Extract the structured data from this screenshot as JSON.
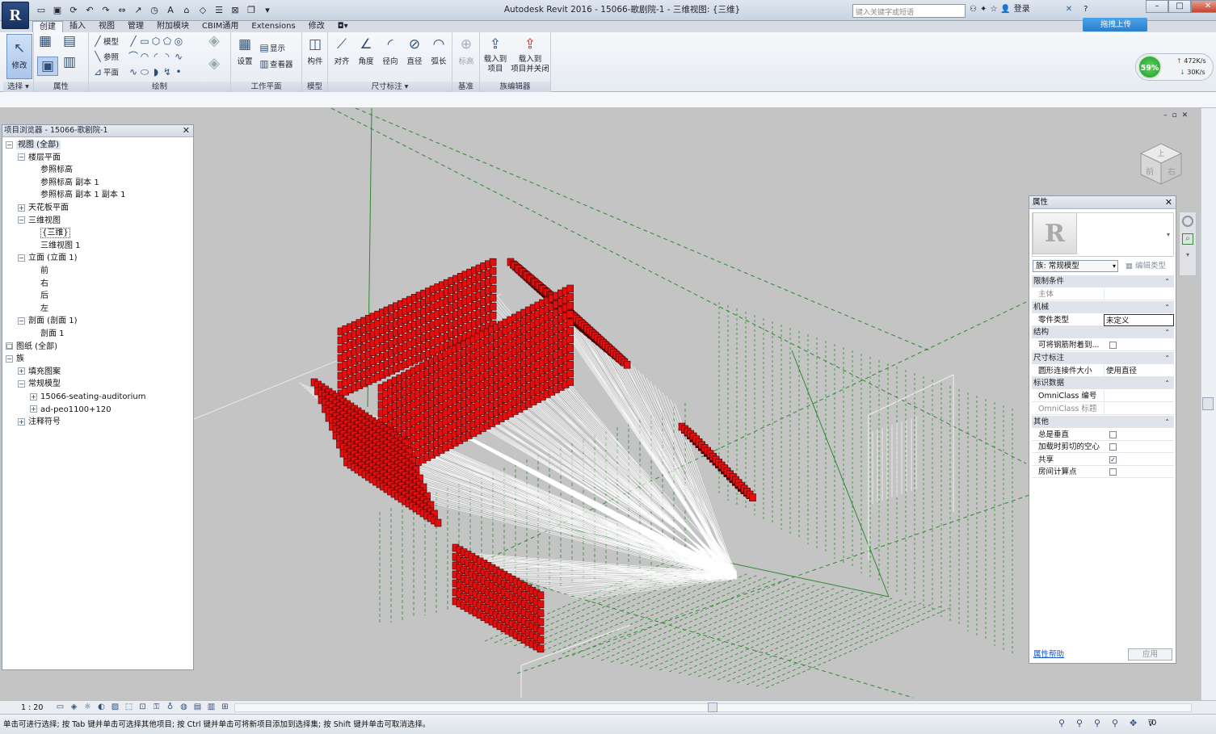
{
  "app": {
    "logo": "R",
    "window_title": "Autodesk Revit 2016 -      15066-歌剧院-1 - 三维视图: {三维}",
    "search_placeholder": "键入关键字或短语",
    "login_label": "登录",
    "upload_label": "拖拽上传",
    "network": {
      "percent": "59%",
      "up": "472K/s",
      "down": "30K/s"
    }
  },
  "quick_access": [
    "open-icon",
    "save-icon",
    "sync-icon",
    "undo-icon",
    "redo-icon",
    "measure-icon",
    "dimension-icon",
    "tag-icon",
    "text-icon",
    "3d-icon",
    "section-icon",
    "thin-lines-icon",
    "close-windows-icon",
    "switch-windows-icon",
    "customize-icon"
  ],
  "tabs": [
    {
      "label": "创建",
      "active": true
    },
    {
      "label": "插入"
    },
    {
      "label": "视图"
    },
    {
      "label": "管理"
    },
    {
      "label": "附加模块"
    },
    {
      "label": "CBIM通用"
    },
    {
      "label": "Extensions"
    },
    {
      "label": "修改"
    }
  ],
  "ribbon": {
    "modify_label": "修改",
    "select_panel": "选择 ▾",
    "properties_panel": "属性",
    "draw_panel": "绘制",
    "draw_items": [
      "模型",
      "参照",
      "平面"
    ],
    "workplane_panel": "工作平面",
    "workplane_items": [
      "设置",
      "显示",
      "查看器"
    ],
    "model_panel": "模型",
    "component_label": "构件",
    "dimension_panel": "尺寸标注 ▾",
    "dimension_items": [
      "对齐",
      "角度",
      "径向",
      "直径",
      "弧长"
    ],
    "datum_panel": "基准",
    "datum_items": [
      "标高"
    ],
    "family_editor_panel": "族编辑器",
    "load_project": "载入到\n项目",
    "load_close": "载入到\n项目并关闭"
  },
  "browser": {
    "title": "项目浏览器 - 15066-歌剧院-1",
    "items": [
      {
        "label": "视图 (全部)",
        "level": 0,
        "exp": "−",
        "selected": true
      },
      {
        "label": "楼层平面",
        "level": 1,
        "exp": "−"
      },
      {
        "label": "参照标高",
        "level": 2
      },
      {
        "label": "参照标高 副本 1",
        "level": 2
      },
      {
        "label": "参照标高 副本 1 副本 1",
        "level": 2
      },
      {
        "label": "天花板平面",
        "level": 1,
        "exp": "+"
      },
      {
        "label": "三维视图",
        "level": 1,
        "exp": "−"
      },
      {
        "label": "{三维}",
        "level": 2,
        "boxed": true
      },
      {
        "label": "三维视图 1",
        "level": 2
      },
      {
        "label": "立面 (立面 1)",
        "level": 1,
        "exp": "−"
      },
      {
        "label": "前",
        "level": 2
      },
      {
        "label": "右",
        "level": 2
      },
      {
        "label": "后",
        "level": 2
      },
      {
        "label": "左",
        "level": 2
      },
      {
        "label": "剖面 (剖面 1)",
        "level": 1,
        "exp": "−"
      },
      {
        "label": "剖面 1",
        "level": 2
      },
      {
        "label": "图纸 (全部)",
        "level": 0,
        "exp": "□"
      },
      {
        "label": "族",
        "level": 0,
        "exp": "−"
      },
      {
        "label": "填充图案",
        "level": 1,
        "exp": "+"
      },
      {
        "label": "常规模型",
        "level": 1,
        "exp": "−"
      },
      {
        "label": "15066-seating-auditorium",
        "level": 2,
        "exp": "+"
      },
      {
        "label": "ad-peo1100+120",
        "level": 2,
        "exp": "+"
      },
      {
        "label": "注释符号",
        "level": 1,
        "exp": "+"
      }
    ]
  },
  "properties": {
    "title": "属性",
    "family_type": "族: 常规模型",
    "edit_type": "编辑类型",
    "help": "属性帮助",
    "apply": "应用",
    "sections": [
      {
        "cat": "限制条件",
        "rows": [
          {
            "k": "主体",
            "v": "",
            "grey": true
          }
        ]
      },
      {
        "cat": "机械",
        "rows": [
          {
            "k": "零件类型",
            "v": "未定义",
            "edit": true
          }
        ]
      },
      {
        "cat": "结构",
        "rows": [
          {
            "k": "可将钢筋附着到...",
            "check": false
          }
        ]
      },
      {
        "cat": "尺寸标注",
        "rows": [
          {
            "k": "圆形连接件大小",
            "v": "使用直径"
          }
        ]
      },
      {
        "cat": "标识数据",
        "rows": [
          {
            "k": "OmniClass 编号",
            "v": ""
          },
          {
            "k": "OmniClass 标题",
            "v": "",
            "grey": true
          }
        ]
      },
      {
        "cat": "其他",
        "rows": [
          {
            "k": "总是垂直",
            "check": false
          },
          {
            "k": "加载时剪切的空心",
            "check": false
          },
          {
            "k": "共享",
            "check": true
          },
          {
            "k": "房间计算点",
            "check": false
          }
        ]
      }
    ]
  },
  "viewcube": {
    "top": "上",
    "front": "前",
    "right": "右"
  },
  "viewbar": {
    "scale": "1 : 20"
  },
  "status": {
    "text": "单击可进行选择; 按 Tab 键并单击可选择其他项目; 按 Ctrl 键并单击可将新项目添加到选择集; 按 Shift 键并单击可取消选择。",
    "filter": ":0"
  }
}
